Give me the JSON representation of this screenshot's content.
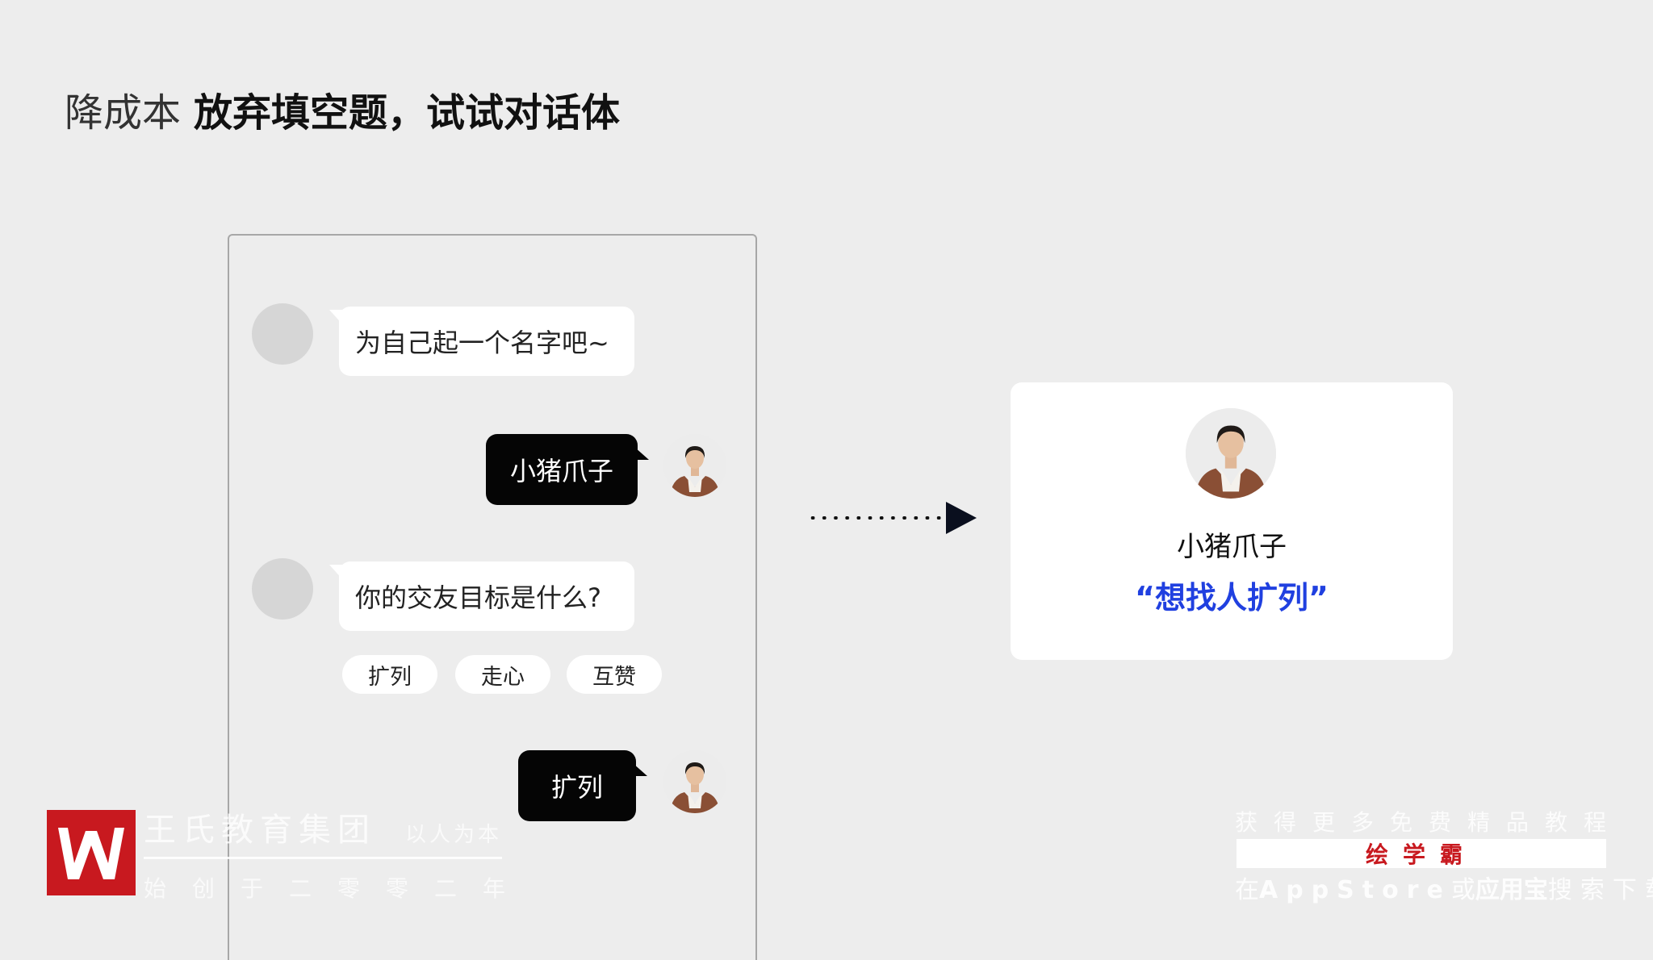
{
  "title": {
    "light": "降成本",
    "bold": "放弃填空题，试试对话体"
  },
  "chat": {
    "q1": "为自己起一个名字吧~",
    "a1": "小猪爪子",
    "q2": "你的交友目标是什么?",
    "options": [
      "扩列",
      "走心",
      "互赞"
    ],
    "a2": "扩列"
  },
  "result": {
    "name": "小猪爪子",
    "quote": "“想找人扩列”"
  },
  "brand": {
    "name": "王氏教育集团",
    "slogan": "以人为本",
    "since": "始创于二零零二年"
  },
  "watermark": {
    "top": "获得更多免费精品教程",
    "app": "绘学霸",
    "bottom_pre": "在",
    "bottom_store": "AppStore",
    "bottom_mid": "或",
    "bottom_app": "应用宝",
    "bottom_post": "搜索下载"
  },
  "colors": {
    "accent": "#2040e0",
    "brand_red": "#c8191f"
  }
}
